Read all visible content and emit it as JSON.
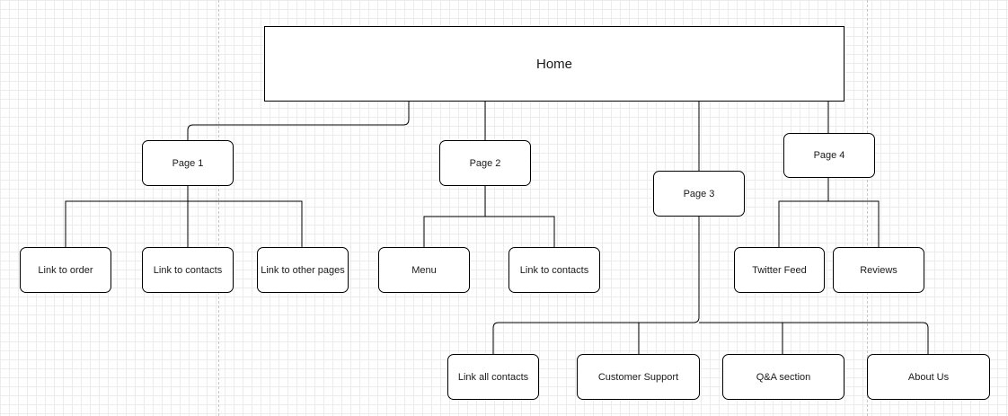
{
  "diagram": {
    "colors": {
      "stroke": "#000000",
      "fill": "#ffffff",
      "grid": "#ececec",
      "text": "#1a1a1a"
    },
    "home": "Home",
    "page1": {
      "label": "Page 1",
      "children": [
        "Link to order",
        "Link to contacts",
        "Link to other pages"
      ]
    },
    "page2": {
      "label": "Page 2",
      "children": [
        "Menu",
        "Link to contacts"
      ]
    },
    "page3": {
      "label": "Page 3",
      "children": [
        "Link all contacts",
        "Customer Support",
        "Q&A section",
        "About Us"
      ]
    },
    "page4": {
      "label": "Page 4",
      "children": [
        "Twitter Feed",
        "Reviews"
      ]
    }
  }
}
